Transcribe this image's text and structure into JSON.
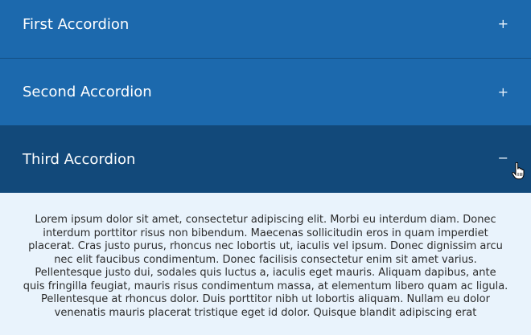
{
  "accordion": {
    "items": [
      {
        "title": "First Accordion",
        "toggle": "+"
      },
      {
        "title": "Second Accordion",
        "toggle": "+"
      },
      {
        "title": "Third Accordion",
        "toggle": "−"
      }
    ],
    "panel_text": "Lorem ipsum dolor sit amet, consectetur adipiscing elit. Morbi eu interdum diam. Donec interdum porttitor risus non bibendum. Maecenas sollicitudin eros in quam imperdiet placerat. Cras justo purus, rhoncus nec lobortis ut, iaculis vel ipsum. Donec dignissim arcu nec elit faucibus condimentum. Donec facilisis consectetur enim sit amet varius. Pellentesque justo dui, sodales quis luctus a, iaculis eget mauris. Aliquam dapibus, ante quis fringilla feugiat, mauris risus condimentum massa, at elementum libero quam ac ligula. Pellentesque at rhoncus dolor. Duis porttitor nibh ut lobortis aliquam. Nullam eu dolor venenatis mauris placerat tristique eget id dolor. Quisque blandit adipiscing erat"
  },
  "colors": {
    "header": "#1c69ad",
    "header_active": "#12497a",
    "panel_bg": "#e9f3fc",
    "text": "#2b2b2b"
  },
  "icons": {
    "cursor": "hand-pointer-icon"
  }
}
